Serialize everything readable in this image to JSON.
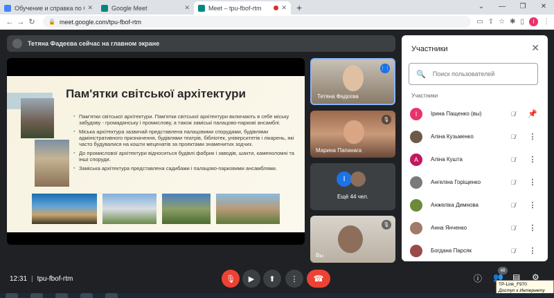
{
  "browser": {
    "tabs": [
      {
        "title": "Обучение и справка по Google",
        "favicon_color": "#4285f4",
        "active": false
      },
      {
        "title": "Google Meet",
        "favicon_color": "#00897b",
        "active": false
      },
      {
        "title": "Meet – tpu-fbof-rtm",
        "favicon_color": "#00897b",
        "active": true
      }
    ],
    "new_tab_icon": "plus-icon",
    "url": "meet.google.com/tpu-fbof-rtm",
    "profile_initial": "I"
  },
  "meet": {
    "presenter_notice": "Тетяна Фадеєва сейчас на главном экране",
    "slide": {
      "title": "Пам'ятки світської архітектури",
      "bullets": [
        "Пам'ятки світської архітектури. Пам'ятки світської архітектури включають в себе міську забудову - громадянську і промислову, а також заміські палацово-паркові ансамблі.",
        "Міська архітектура зазвичай представлена палацовими спорудами, будівлями адміністративного призначення, будівлями театрів, бібліотек, університетів і лікарень, які часто будувалися на кошти меценатів за проектами знаменитих зодчих.",
        "До промислової архітектури відноситься будівлі фабрик і заводів, шахти, каменоломні та інші споруди.",
        "Заміська архітектура представлена садибами і палацово-парковими ансамблями."
      ]
    },
    "tiles": [
      {
        "name": "Тетяна Фадєєва"
      },
      {
        "name": "Марина Папанага"
      },
      {
        "more_text": "Ещё 44 чел.",
        "avatar_initial": "I"
      },
      {
        "name": "Вы"
      }
    ],
    "meeting_time": "12:31",
    "meeting_code": "tpu-fbof-rtm",
    "participant_count": "48",
    "tooltip": {
      "line1": "TP-Link_F970",
      "line2": "Доступ к Интернету"
    }
  },
  "panel": {
    "title": "Участники",
    "search_placeholder": "Поиск пользователей",
    "section_label": "Участники",
    "participants": [
      {
        "name": "Ірина Пащенко (вы)",
        "initial": "I",
        "color": "#e8336b"
      },
      {
        "name": "Аліна Кузьменко",
        "initial": "",
        "color": "#6b5a4a"
      },
      {
        "name": "Аліна Кушта",
        "initial": "A",
        "color": "#c2185b"
      },
      {
        "name": "Ангеліна Горіщенко",
        "initial": "",
        "color": "#7a7a7a"
      },
      {
        "name": "Анжеліка Димнова",
        "initial": "",
        "color": "#6b8a3a"
      },
      {
        "name": "Анна Янченко",
        "initial": "",
        "color": "#a07a6a"
      },
      {
        "name": "Богдана Парсяк",
        "initial": "",
        "color": "#9a4a4a"
      }
    ]
  }
}
